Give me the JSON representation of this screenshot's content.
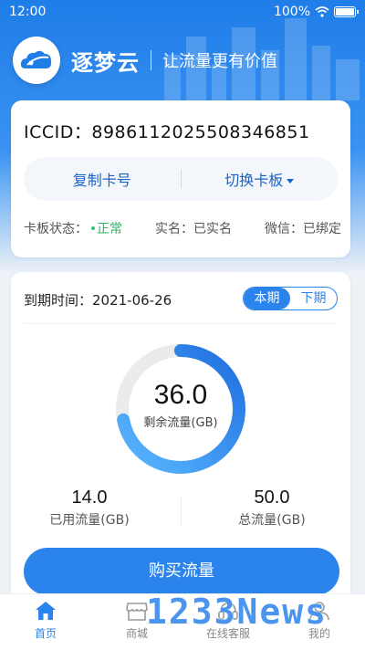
{
  "status_bar": {
    "time": "12:00",
    "battery": "100%"
  },
  "brand": {
    "name": "逐梦云",
    "slogan": "让流量更有价值"
  },
  "card": {
    "iccid": "ICCID：8986112025508346851",
    "copy_label": "复制卡号",
    "switch_label": "切换卡板",
    "status_label": "卡板状态：",
    "status_value": "正常",
    "realname": "实名：已实名",
    "wechat": "微信：已绑定"
  },
  "usage": {
    "expiry": "到期时间：2021-06-26",
    "tab_current": "本期",
    "tab_next": "下期",
    "remaining_value": "36.0",
    "remaining_label": "剩余流量(GB)",
    "remaining_fraction": 0.72,
    "used_value": "14.0",
    "used_label": "已用流量(GB)",
    "total_value": "50.0",
    "total_label": "总流量(GB)",
    "buy_label": "购买流量"
  },
  "tabs": [
    {
      "label": "首页"
    },
    {
      "label": "商城"
    },
    {
      "label": "在线客服"
    },
    {
      "label": "我的"
    }
  ],
  "watermark": "1233News",
  "colors": {
    "accent": "#2b83ec",
    "ok": "#2cb563"
  }
}
